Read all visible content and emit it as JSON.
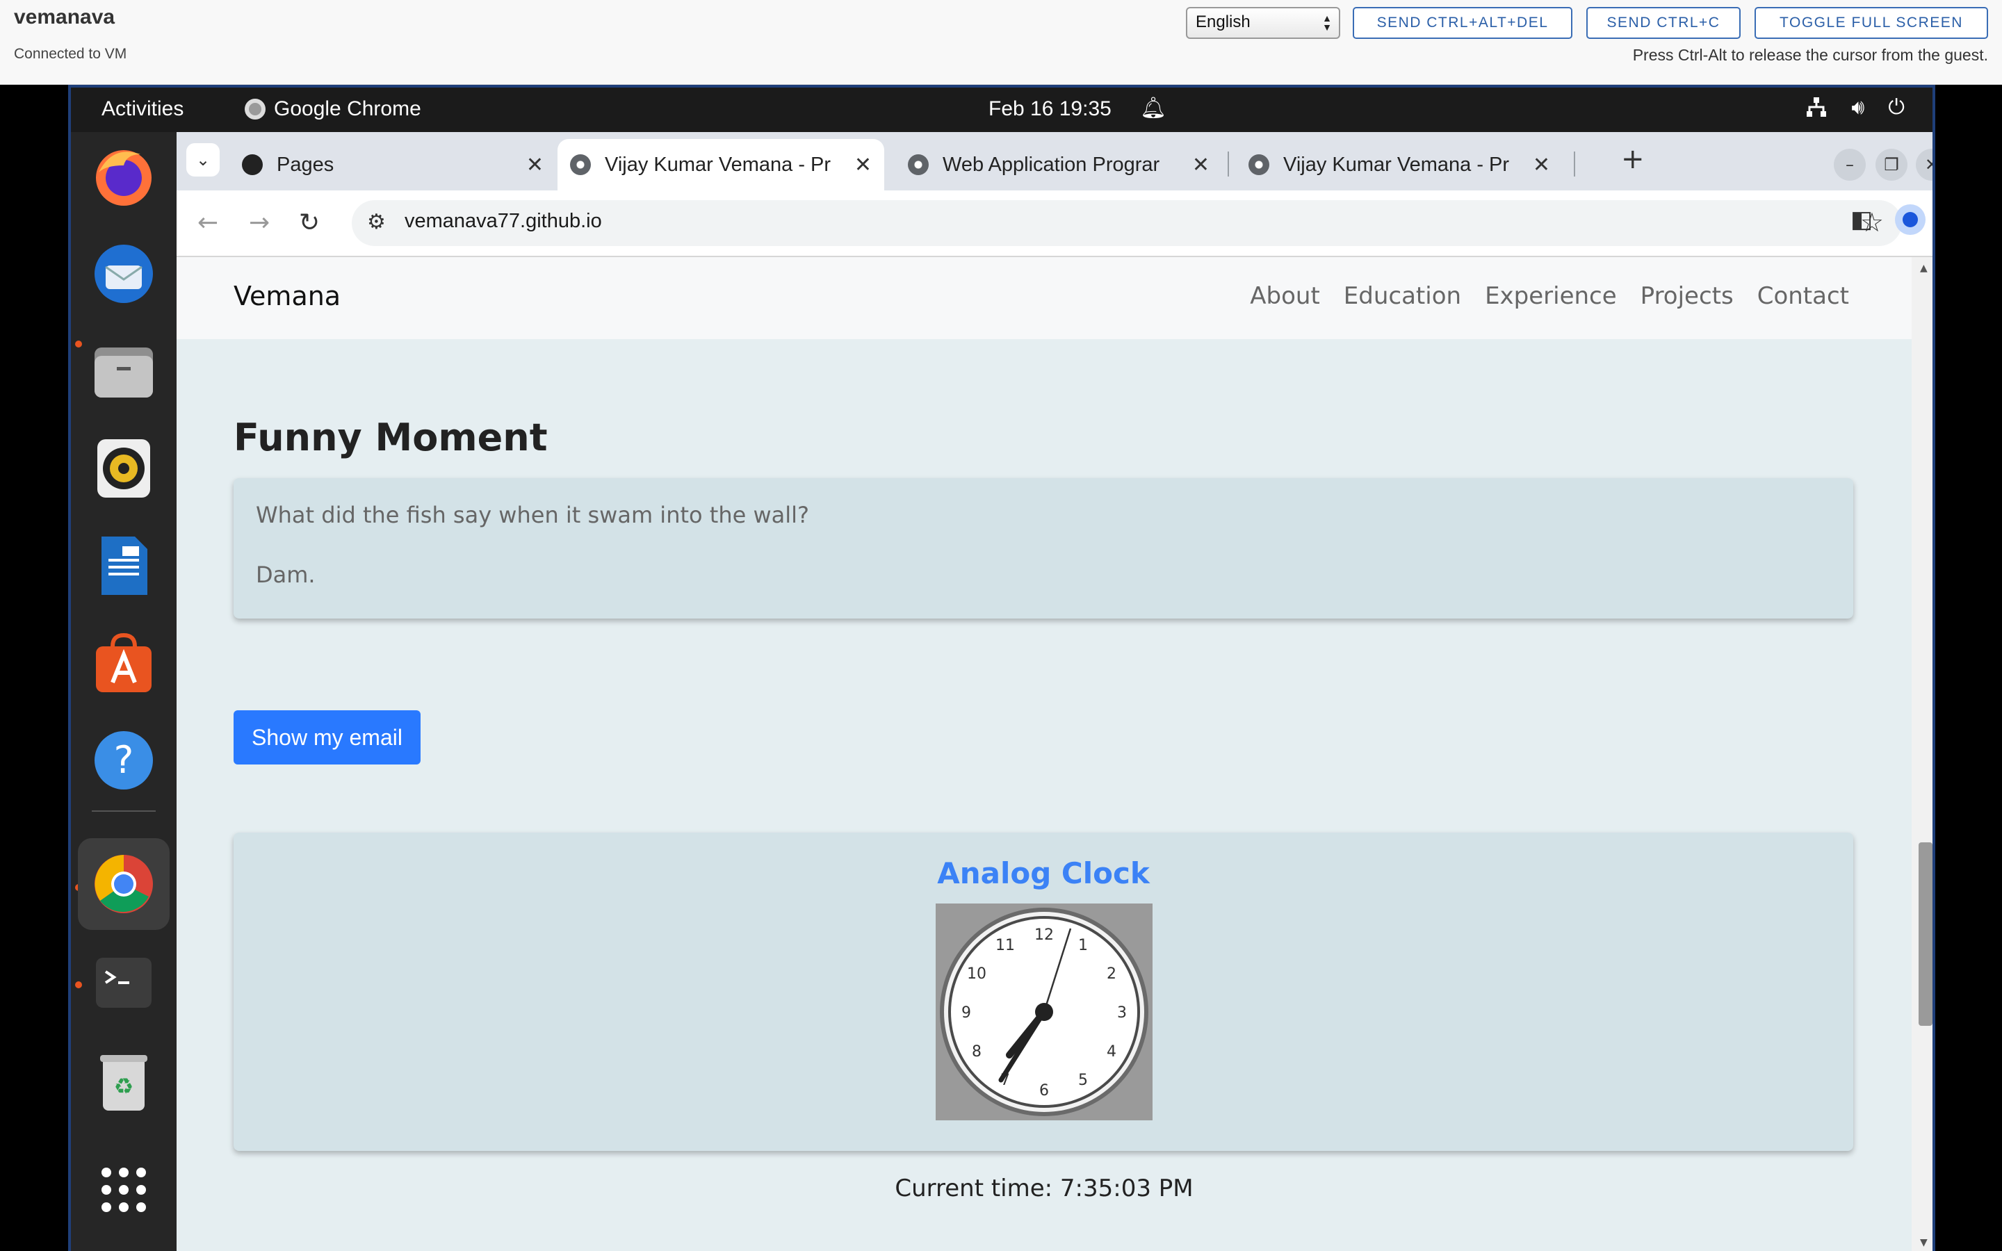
{
  "vm": {
    "name": "vemanava",
    "status": "Connected to VM",
    "language": "English",
    "buttons": [
      "SEND CTRL+ALT+DEL",
      "SEND CTRL+C",
      "TOGGLE FULL SCREEN"
    ],
    "hint": "Press Ctrl-Alt to release the cursor from the guest."
  },
  "topbar": {
    "activities": "Activities",
    "app_name": "Google Chrome",
    "datetime": "Feb 16  19:35"
  },
  "browser": {
    "tabs": [
      {
        "title": "Pages",
        "active": false
      },
      {
        "title": "Vijay Kumar Vemana - Pr",
        "active": true
      },
      {
        "title": "Web Application Prograr",
        "active": false
      },
      {
        "title": "Vijay Kumar Vemana - Pr",
        "active": false
      }
    ],
    "url": "vemanava77.github.io"
  },
  "site": {
    "brand": "Vemana",
    "nav": [
      "About",
      "Education",
      "Experience",
      "Projects",
      "Contact"
    ],
    "section_title": "Funny Moment",
    "joke_question": "What did the fish say when it swam into the wall?",
    "joke_answer": "Dam.",
    "email_button": "Show my email",
    "clock_title": "Analog Clock",
    "clock_numbers": [
      "12",
      "1",
      "2",
      "3",
      "4",
      "5",
      "6",
      "7",
      "8",
      "9",
      "10",
      "11"
    ],
    "current_time": "Current time: 7:35:03 PM"
  },
  "colors": {
    "accent": "#2979ff",
    "clock_title": "#3b82f6",
    "page_bg": "#e5eef1",
    "card_bg": "#d3e2e7"
  }
}
